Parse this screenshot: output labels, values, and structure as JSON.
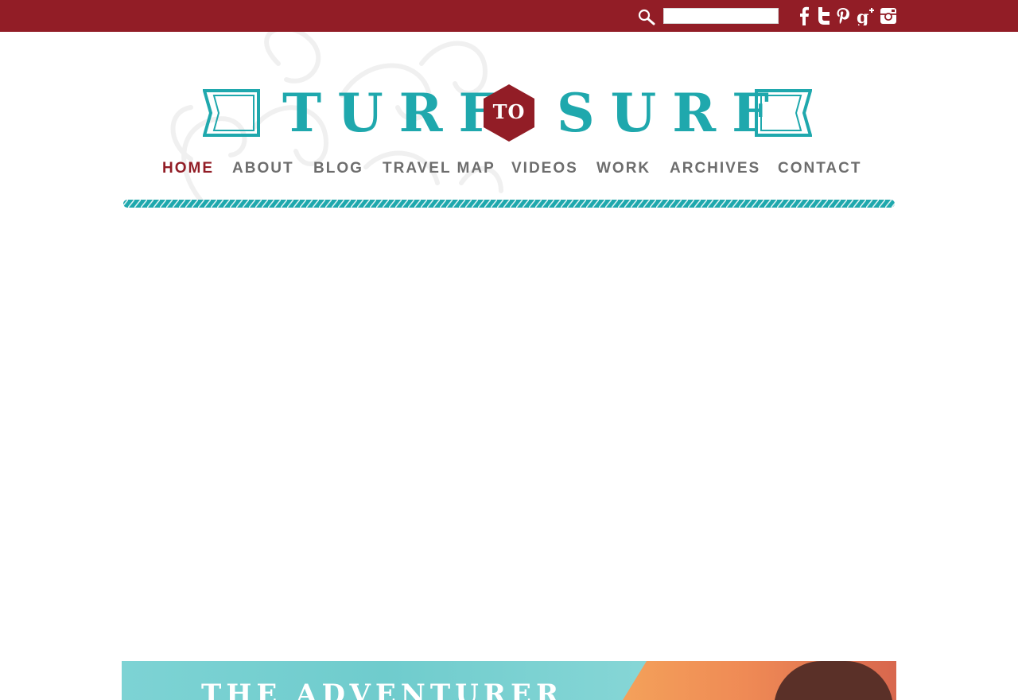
{
  "topbar": {
    "search": {
      "icon": "search-icon",
      "placeholder": "",
      "value": ""
    },
    "social": [
      "facebook-icon",
      "twitter-icon",
      "pinterest-icon",
      "google-plus-icon",
      "instagram-icon"
    ]
  },
  "logo": {
    "word_left": "TURF",
    "word_center": "TO",
    "word_right": "SURF",
    "colors": {
      "teal": "#1fa8ad",
      "red": "#921d26"
    }
  },
  "nav": {
    "items": [
      {
        "label": "HOME",
        "active": true
      },
      {
        "label": "ABOUT",
        "active": false
      },
      {
        "label": "BLOG",
        "active": false
      },
      {
        "label": "TRAVEL MAP",
        "active": false
      },
      {
        "label": "VIDEOS",
        "active": false
      },
      {
        "label": "WORK",
        "active": false
      },
      {
        "label": "ARCHIVES",
        "active": false
      },
      {
        "label": "CONTACT",
        "active": false
      }
    ]
  },
  "banner": {
    "title": "THE ADVENTURER"
  },
  "colors": {
    "topbar": "#921d26",
    "nav_text": "#6d6d6d",
    "nav_active": "#921d26",
    "accent_teal": "#1fa8ad"
  }
}
